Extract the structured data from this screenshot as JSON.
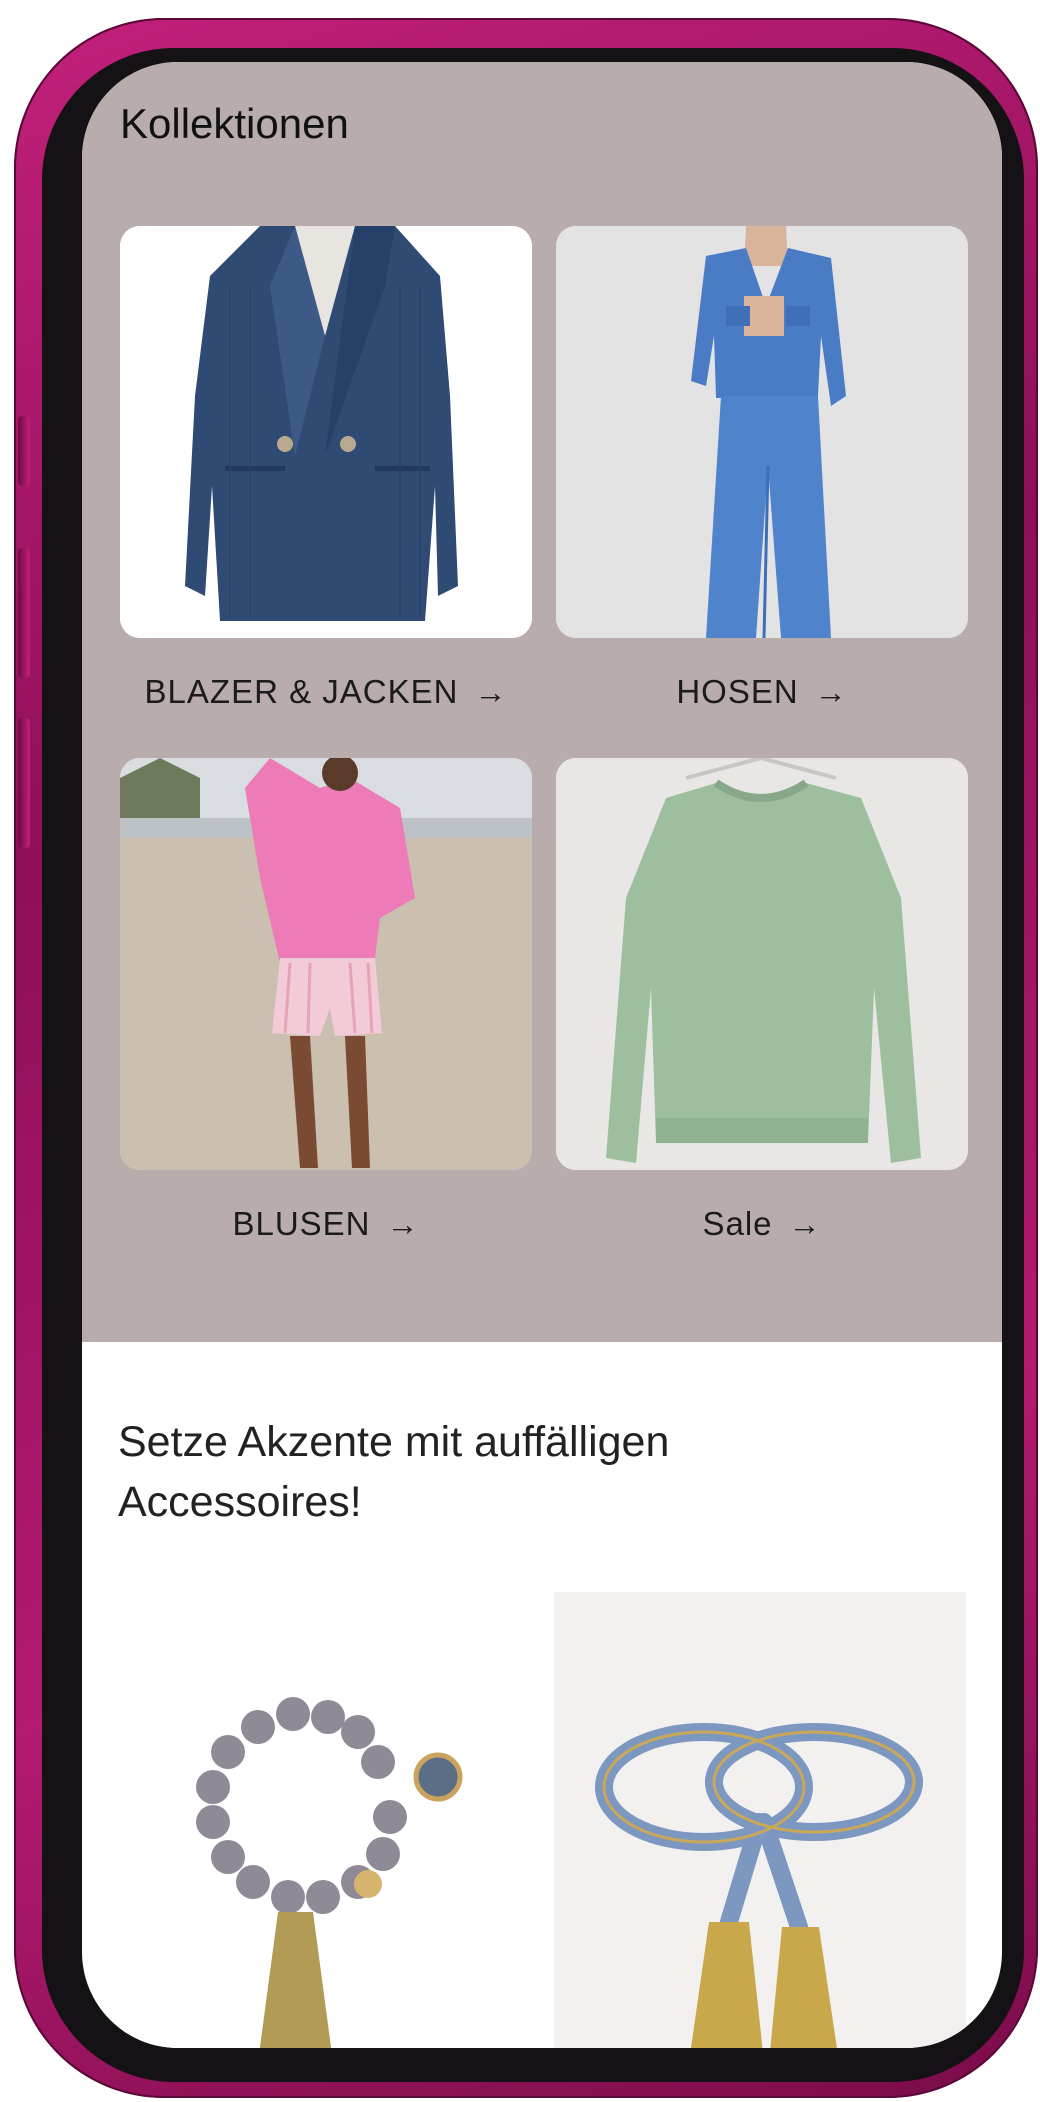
{
  "collections": {
    "title": "Kollektionen",
    "items": [
      {
        "label": "BLAZER & JACKEN",
        "arrow": "→",
        "image": "navy-corduroy-blazer"
      },
      {
        "label": "HOSEN",
        "arrow": "→",
        "image": "blue-denim-jacket-and-pants"
      },
      {
        "label": "BLUSEN",
        "arrow": "→",
        "image": "pink-blouse-on-beach"
      },
      {
        "label": "Sale",
        "arrow": "→",
        "image": "sage-green-sweater"
      }
    ]
  },
  "accessories": {
    "title": "Setze Akzente mit auffälligen Accessoires!",
    "items": [
      {
        "image": "beaded-bracelet-with-tassel"
      },
      {
        "image": "braided-belt-with-tassels"
      }
    ]
  },
  "colors": {
    "frame": "#b31a70",
    "collections_bg": "#b8acad",
    "text": "#1b1b1b"
  }
}
